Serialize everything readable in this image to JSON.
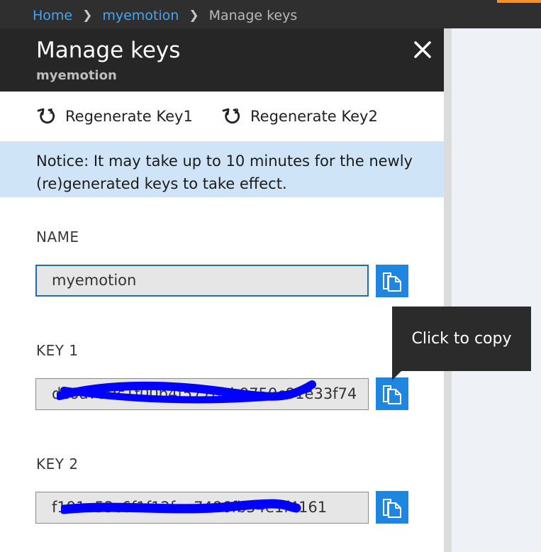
{
  "breadcrumb": {
    "items": [
      "Home",
      "myemotion"
    ],
    "current": "Manage keys"
  },
  "panel": {
    "title": "Manage keys",
    "subtitle": "myemotion"
  },
  "commands": [
    {
      "label": "Regenerate Key1",
      "icon": "regenerate-icon-1"
    },
    {
      "label": "Regenerate Key2",
      "icon": "regenerate-icon-2"
    }
  ],
  "notice": {
    "text": "Notice: It may take up to 10 minutes for the newly (re)generated keys to take effect."
  },
  "fields": {
    "name": {
      "label": "NAME",
      "value": "myemotion"
    },
    "key1": {
      "label": "KEY 1",
      "value": "dc6d799c1f00b4f577bbb9750c91e33f74"
    },
    "key2": {
      "label": "KEY 2",
      "value": "f191e53c6f1f12fae7486fb54e1f4161"
    }
  },
  "tooltip": {
    "text": "Click to copy"
  },
  "colors": {
    "accent": "#1f86e0",
    "header_bg": "#262626",
    "notice_bg": "#cfe4f6",
    "link": "#4aa3ec",
    "redaction": "#0000ff"
  }
}
